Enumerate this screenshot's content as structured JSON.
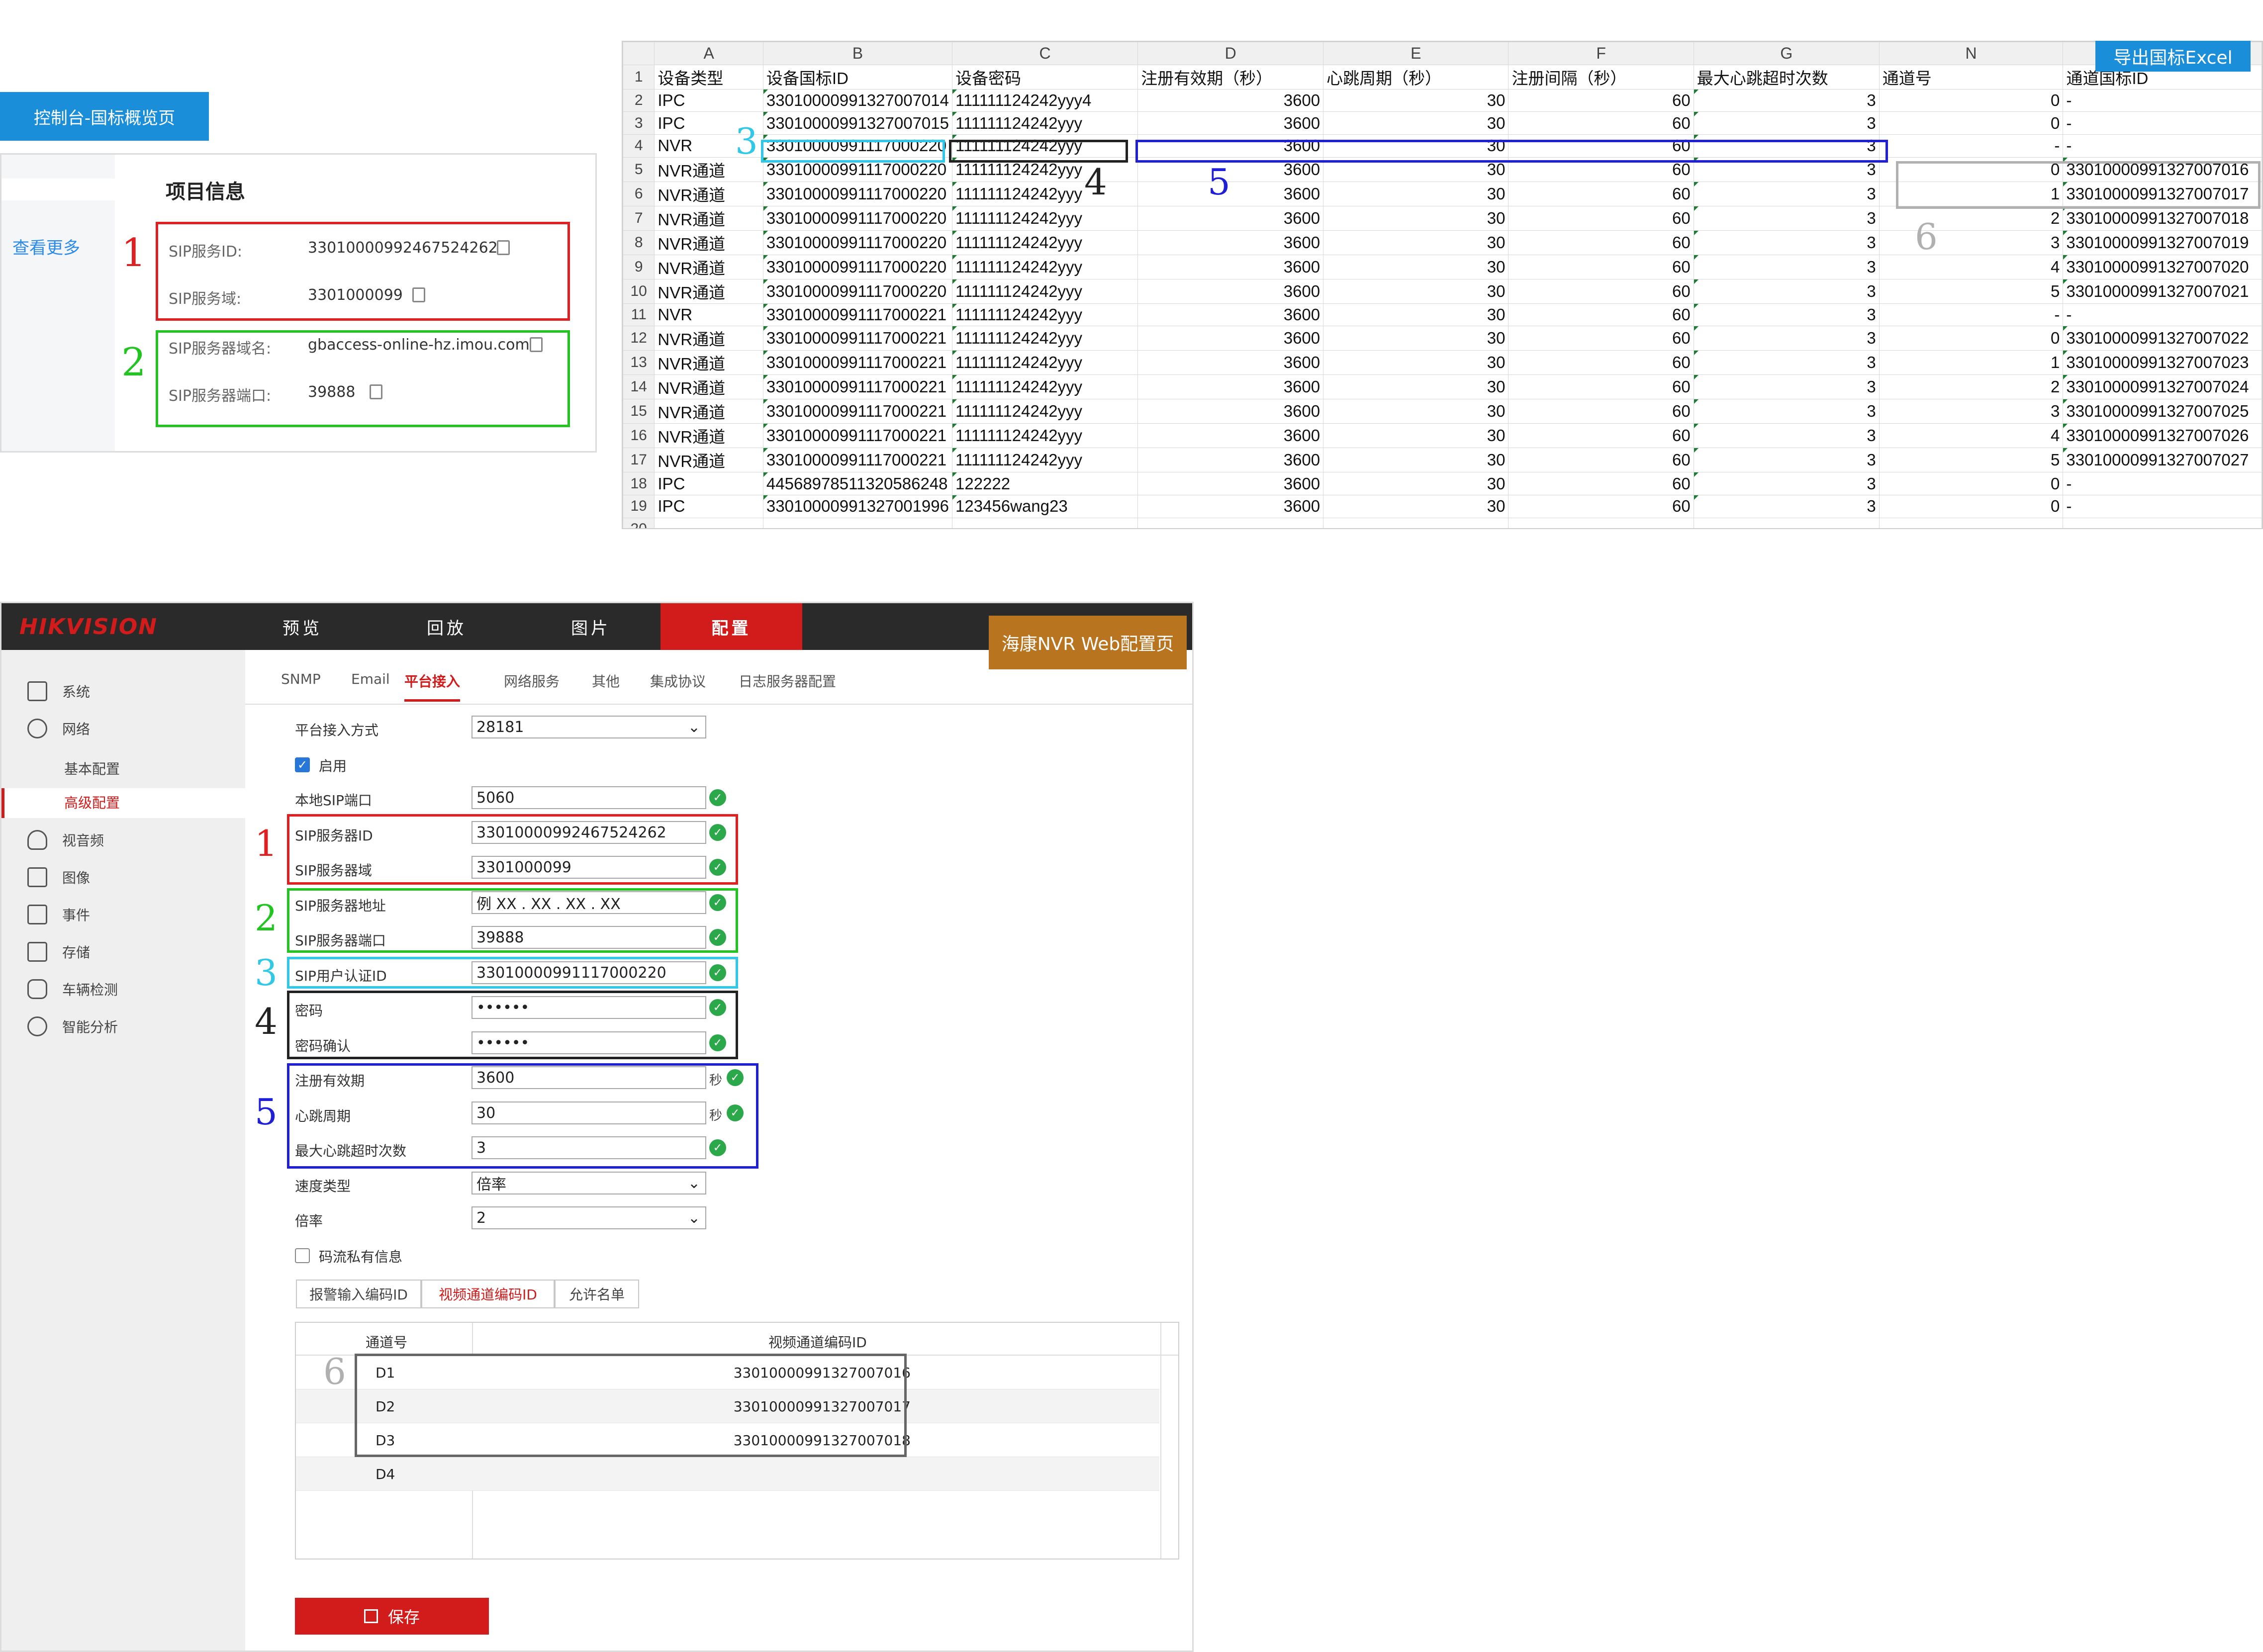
{
  "console": {
    "tag_label": "控制台-国标概览页",
    "see_more": "查看更多",
    "section_title": "项目信息",
    "fields": [
      {
        "label": "SIP服务ID:",
        "value": "33010000992467524262"
      },
      {
        "label": "SIP服务域:",
        "value": "3301000099"
      },
      {
        "label": "SIP服务器域名:",
        "value": "gbaccess-online-hz.imou.com"
      },
      {
        "label": "SIP服务器端口:",
        "value": "39888"
      }
    ]
  },
  "annotations": {
    "n1": "1",
    "n2": "2",
    "n3": "3",
    "n4": "4",
    "n5": "5",
    "n6": "6"
  },
  "sheet": {
    "export_label": "导出国标Excel",
    "col_letters": [
      "A",
      "B",
      "C",
      "D",
      "E",
      "F",
      "G",
      "N",
      ""
    ],
    "header": [
      "设备类型",
      "设备国标ID",
      "设备密码",
      "注册有效期（秒）",
      "心跳周期（秒）",
      "注册间隔（秒）",
      "最大心跳超时次数",
      "通道号",
      "通道国标ID"
    ],
    "rows": [
      [
        "IPC",
        "33010000991327007014",
        "111111124242yyy4",
        "3600",
        "30",
        "60",
        "3",
        "0",
        "-"
      ],
      [
        "IPC",
        "33010000991327007015",
        "111111124242yyy",
        "3600",
        "30",
        "60",
        "3",
        "0",
        "-"
      ],
      [
        "NVR",
        "33010000991117000220",
        "111111124242yyy",
        "3600",
        "30",
        "60",
        "3",
        "-",
        "-"
      ],
      [
        "NVR通道",
        "33010000991117000220",
        "111111124242yyy",
        "3600",
        "30",
        "60",
        "3",
        "0",
        "33010000991327007016"
      ],
      [
        "NVR通道",
        "33010000991117000220",
        "111111124242yyy",
        "3600",
        "30",
        "60",
        "3",
        "1",
        "33010000991327007017"
      ],
      [
        "NVR通道",
        "33010000991117000220",
        "111111124242yyy",
        "3600",
        "30",
        "60",
        "3",
        "2",
        "33010000991327007018"
      ],
      [
        "NVR通道",
        "33010000991117000220",
        "111111124242yyy",
        "3600",
        "30",
        "60",
        "3",
        "3",
        "33010000991327007019"
      ],
      [
        "NVR通道",
        "33010000991117000220",
        "111111124242yyy",
        "3600",
        "30",
        "60",
        "3",
        "4",
        "33010000991327007020"
      ],
      [
        "NVR通道",
        "33010000991117000220",
        "111111124242yyy",
        "3600",
        "30",
        "60",
        "3",
        "5",
        "33010000991327007021"
      ],
      [
        "NVR",
        "33010000991117000221",
        "111111124242yyy",
        "3600",
        "30",
        "60",
        "3",
        "-",
        "-"
      ],
      [
        "NVR通道",
        "33010000991117000221",
        "111111124242yyy",
        "3600",
        "30",
        "60",
        "3",
        "0",
        "33010000991327007022"
      ],
      [
        "NVR通道",
        "33010000991117000221",
        "111111124242yyy",
        "3600",
        "30",
        "60",
        "3",
        "1",
        "33010000991327007023"
      ],
      [
        "NVR通道",
        "33010000991117000221",
        "111111124242yyy",
        "3600",
        "30",
        "60",
        "3",
        "2",
        "33010000991327007024"
      ],
      [
        "NVR通道",
        "33010000991117000221",
        "111111124242yyy",
        "3600",
        "30",
        "60",
        "3",
        "3",
        "33010000991327007025"
      ],
      [
        "NVR通道",
        "33010000991117000221",
        "111111124242yyy",
        "3600",
        "30",
        "60",
        "3",
        "4",
        "33010000991327007026"
      ],
      [
        "NVR通道",
        "33010000991117000221",
        "111111124242yyy",
        "3600",
        "30",
        "60",
        "3",
        "5",
        "33010000991327007027"
      ],
      [
        "IPC",
        "44568978511320586248",
        "122222",
        "3600",
        "30",
        "60",
        "3",
        "0",
        "-"
      ],
      [
        "IPC",
        "33010000991327001996",
        "123456wang23",
        "3600",
        "30",
        "60",
        "3",
        "0",
        "-"
      ]
    ]
  },
  "hik": {
    "logo": "HIKVISION",
    "nav": [
      "预览",
      "回放",
      "图片",
      "配置"
    ],
    "page_tag": "海康NVR Web配置页",
    "side": [
      "系统",
      "网络",
      "基本配置",
      "高级配置",
      "视音频",
      "图像",
      "事件",
      "存储",
      "车辆检测",
      "智能分析"
    ],
    "tabs": [
      "SNMP",
      "Email",
      "平台接入",
      "网络服务",
      "其他",
      "集成协议",
      "日志服务器配置"
    ],
    "form": {
      "access_mode_label": "平台接入方式",
      "access_mode_value": "28181",
      "enable_label": "启用",
      "local_port_label": "本地SIP端口",
      "local_port_value": "5060",
      "sip_id_label": "SIP服务器ID",
      "sip_id_value": "33010000992467524262",
      "sip_domain_label": "SIP服务器域",
      "sip_domain_value": "3301000099",
      "sip_addr_label": "SIP服务器地址",
      "sip_addr_value": "例 XX . XX . XX . XX",
      "sip_port_label": "SIP服务器端口",
      "sip_port_value": "39888",
      "auth_id_label": "SIP用户认证ID",
      "auth_id_value": "33010000991117000220",
      "pwd_label": "密码",
      "pwd_value": "••••••",
      "pwd2_label": "密码确认",
      "pwd2_value": "••••••",
      "reg_label": "注册有效期",
      "reg_value": "3600",
      "reg_unit": "秒",
      "hb_label": "心跳周期",
      "hb_value": "30",
      "hb_unit": "秒",
      "max_label": "最大心跳超时次数",
      "max_value": "3",
      "speed_label": "速度类型",
      "speed_value": "倍率",
      "rate_label": "倍率",
      "rate_value": "2",
      "private_label": "码流私有信息"
    },
    "subtabs": [
      "报警输入编码ID",
      "视频通道编码ID",
      "允许名单"
    ],
    "vtable": {
      "headers": [
        "通道号",
        "视频通道编码ID"
      ],
      "rows": [
        [
          "D1",
          "33010000991327007016"
        ],
        [
          "D2",
          "33010000991327007017"
        ],
        [
          "D3",
          "33010000991327007018"
        ],
        [
          "D4",
          ""
        ]
      ]
    },
    "save_label": "保存"
  }
}
